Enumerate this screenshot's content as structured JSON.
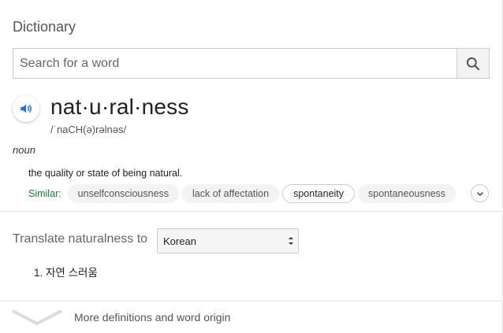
{
  "card": {
    "title": "Dictionary"
  },
  "search": {
    "placeholder": "Search for a word",
    "value": "",
    "button_icon": "search-icon"
  },
  "entry": {
    "speaker_icon": "speaker-icon",
    "word": "nat·u·ral·ness",
    "phonetic": "/ˈnaCH(ə)rəlnəs/",
    "part_of_speech": "noun",
    "definition": "the quality or state of being natural.",
    "similar_label": "Similar:",
    "similar": [
      "unselfconsciousness",
      "lack of affectation",
      "spontaneity",
      "spontaneousness"
    ],
    "similar_more_icon": "chevron-down-icon"
  },
  "translate": {
    "label": "Translate naturalness to",
    "language": "Korean",
    "result": "1. 자연 스러움"
  },
  "footer": {
    "more_label": "More definitions and word origin",
    "icon": "chevron-down-icon"
  },
  "colors": {
    "accent_blue": "#1a73e8",
    "similar_green": "#188038",
    "divider": "#e6e6e6"
  }
}
